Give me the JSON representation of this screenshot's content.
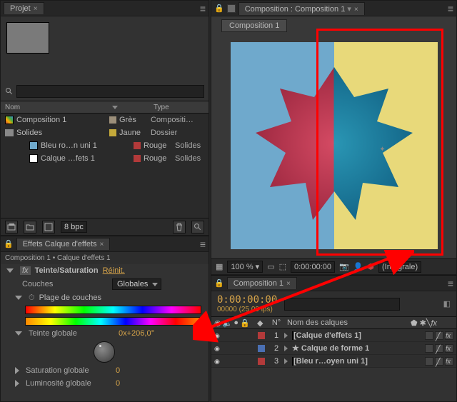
{
  "project": {
    "tab_label": "Projet",
    "search_placeholder": "",
    "columns": {
      "c1": "Nom",
      "c2": "",
      "c3": "Type"
    },
    "assets": [
      {
        "name": "Composition 1",
        "label": "Grès",
        "label_color": "#9c8f7a",
        "type": "Compositi…",
        "icon": "comp",
        "indent": 0
      },
      {
        "name": "Solides",
        "label": "Jaune",
        "label_color": "#c4a93a",
        "type": "Dossier",
        "icon": "folder",
        "indent": 0
      },
      {
        "name": "Bleu ro…n uni 1",
        "label": "Rouge",
        "label_color": "#b23a3a",
        "type": "Solides",
        "icon": "solid",
        "swatch": "#6fa9cc",
        "indent": 2
      },
      {
        "name": "Calque …fets 1",
        "label": "Rouge",
        "label_color": "#b23a3a",
        "type": "Solides",
        "icon": "solid",
        "swatch": "#ffffff",
        "indent": 2
      }
    ],
    "bpc_label": "8 bpc"
  },
  "effects": {
    "tab_label": "Effets Calque d'effets",
    "header": "Composition 1 • Calque d'effets 1",
    "fx_name": "Teinte/Saturation",
    "reset": "Réinit.",
    "layers_label": "Couches",
    "layers_value": "Globales",
    "range_label": "Plage de couches",
    "hue_label": "Teinte globale",
    "hue_value": "0x+206,0°",
    "sat_label": "Saturation globale",
    "sat_value": "0",
    "lum_label": "Luminosité globale",
    "lum_value": "0"
  },
  "viewer": {
    "tab_label": "Composition : Composition 1",
    "inner_tab": "Composition 1",
    "zoom": "100 %",
    "timecode": "0:00:00:00",
    "quality": "(Intégrale)"
  },
  "timeline": {
    "tab_label": "Composition 1",
    "timecode": "0:00:00:00",
    "frame_info": "00000 (25.00 ips)",
    "search_placeholder": "",
    "columns": {
      "num": "N°",
      "name": "Nom des calques"
    },
    "layers": [
      {
        "num": "1",
        "name": "[Calque d'effets 1]",
        "color": "#b23a3a",
        "swatch": "#ffffff",
        "bold": true
      },
      {
        "num": "2",
        "name": "Calque de forme 1",
        "color": "#4a6fb2",
        "star": true,
        "bold": true
      },
      {
        "num": "3",
        "name": "[Bleu r…oyen uni 1]",
        "color": "#b23a3a",
        "swatch": "#6fa9cc",
        "bold": true
      }
    ]
  }
}
